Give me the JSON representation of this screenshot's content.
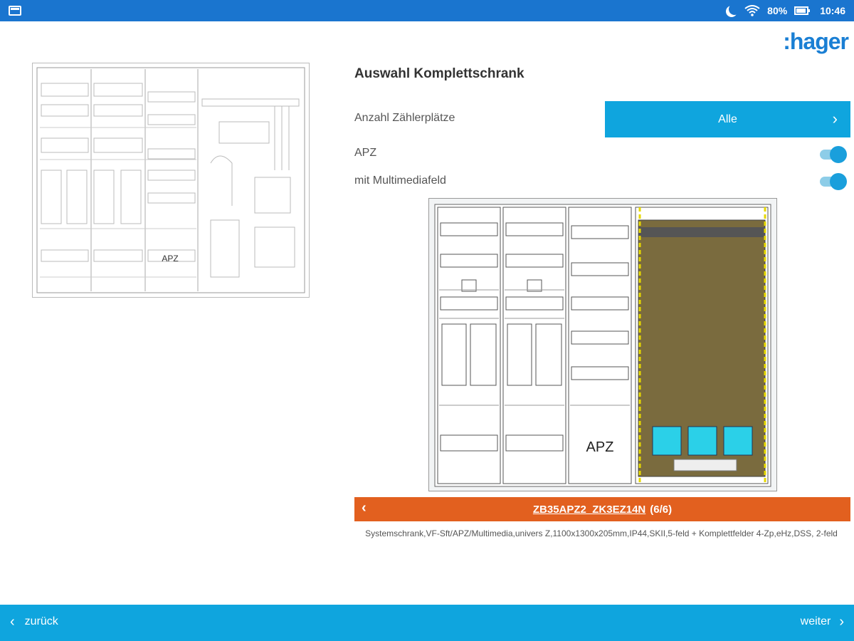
{
  "status_bar": {
    "battery": "80%",
    "time": "10:46",
    "icons": [
      "app-icon",
      "moon-icon",
      "wifi-icon",
      "battery-icon"
    ]
  },
  "brand": {
    "logo_text": ":hager",
    "color": "#1a7fd4"
  },
  "thumbnail": {
    "apz_label": "APZ"
  },
  "config": {
    "title": "Auswahl Komplettschrank",
    "meter_slots_label": "Anzahl Zählerplätze",
    "meter_slots_value": "Alle",
    "apz_label": "APZ",
    "apz_enabled": true,
    "multimedia_label": "mit Multimediafeld",
    "multimedia_enabled": true
  },
  "cabinet": {
    "apz_label": "APZ"
  },
  "pager": {
    "code": "ZB35APZ2_ZK3EZ14N",
    "count": "(6/6)",
    "color": "#e2601f"
  },
  "description": "Systemschrank,VF-Sft/APZ/Multimedia,univers Z,1100x1300x205mm,IP44,SKII,5-feld + Komplettfelder 4-Zp,eHz,DSS, 2-feld",
  "navigation": {
    "back_label": "zurück",
    "next_label": "weiter",
    "bar_color": "#0fa5de"
  }
}
